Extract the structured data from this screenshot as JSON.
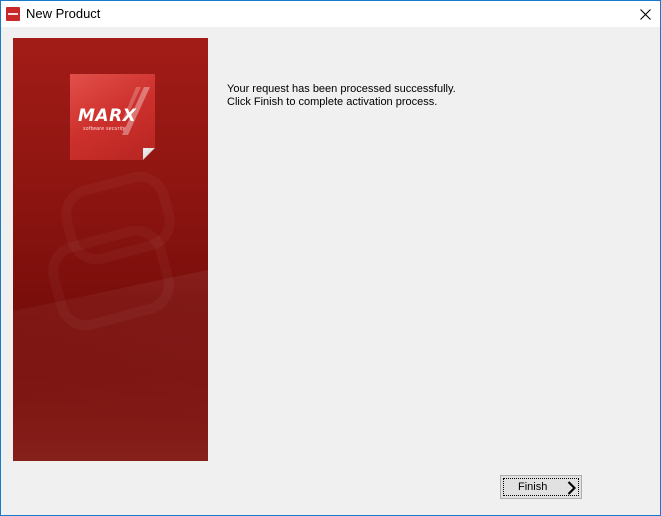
{
  "window": {
    "title": "New Product",
    "app_icon": "marx-app-icon",
    "close_icon": "close-icon"
  },
  "side_panel": {
    "logo": {
      "word": "MARX",
      "tagline": "software security"
    }
  },
  "content": {
    "message_line_1": "Your request has been processed successfully.",
    "message_line_2": "Click Finish to complete activation process."
  },
  "buttons": {
    "finish_label": "Finish",
    "finish_icon": "chevron-right-icon"
  },
  "colors": {
    "window_border": "#1979ca",
    "brand_red": "#c8282a",
    "panel_red": "#8e1511",
    "dialog_bg": "#f0f0f0"
  }
}
